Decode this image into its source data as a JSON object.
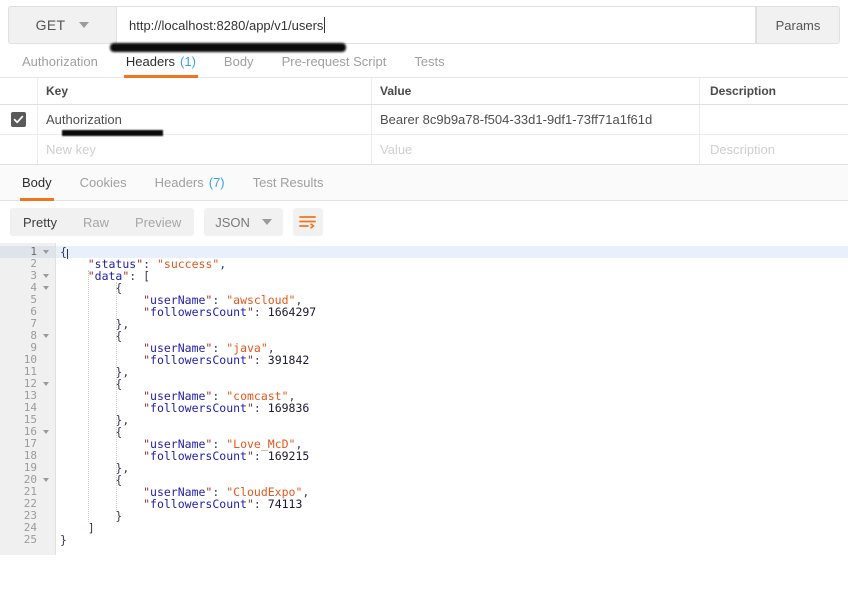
{
  "request": {
    "method": "GET",
    "url": "http://localhost:8280/app/v1/users",
    "params_label": "Params",
    "tabs": [
      {
        "label": "Authorization",
        "count": "",
        "active": false
      },
      {
        "label": "Headers",
        "count": "(1)",
        "active": true
      },
      {
        "label": "Body",
        "count": "",
        "active": false
      },
      {
        "label": "Pre-request Script",
        "count": "",
        "active": false
      },
      {
        "label": "Tests",
        "count": "",
        "active": false
      }
    ]
  },
  "headers_table": {
    "columns": {
      "key": "Key",
      "value": "Value",
      "description": "Description"
    },
    "rows": [
      {
        "checked": true,
        "key": "Authorization",
        "value": "Bearer 8c9b9a78-f504-33d1-9df1-73ff71a1f61d",
        "description": ""
      }
    ],
    "new_row": {
      "key_placeholder": "New key",
      "value_placeholder": "Value",
      "description_placeholder": "Description"
    }
  },
  "response": {
    "tabs": [
      {
        "label": "Body",
        "count": "",
        "active": true
      },
      {
        "label": "Cookies",
        "count": "",
        "active": false
      },
      {
        "label": "Headers",
        "count": "(7)",
        "active": false
      },
      {
        "label": "Test Results",
        "count": "",
        "active": false
      }
    ],
    "view_modes": [
      {
        "label": "Pretty",
        "active": true
      },
      {
        "label": "Raw",
        "active": false
      },
      {
        "label": "Preview",
        "active": false
      }
    ],
    "format": "JSON",
    "wrap_icon": "word-wrap-icon",
    "accent_color": "#f2741c",
    "link_color": "#3aa3e3",
    "body_json": {
      "status": "success",
      "data": [
        {
          "userName": "awscloud",
          "followersCount": 1664297
        },
        {
          "userName": "java",
          "followersCount": 391842
        },
        {
          "userName": "comcast",
          "followersCount": 169836
        },
        {
          "userName": "Love_McD",
          "followersCount": 169215
        },
        {
          "userName": "CloudExpo",
          "followersCount": 74113
        }
      ]
    },
    "line_count": 25,
    "active_line": 1,
    "fold_lines": [
      1,
      3,
      4,
      8,
      12,
      16,
      20
    ]
  }
}
